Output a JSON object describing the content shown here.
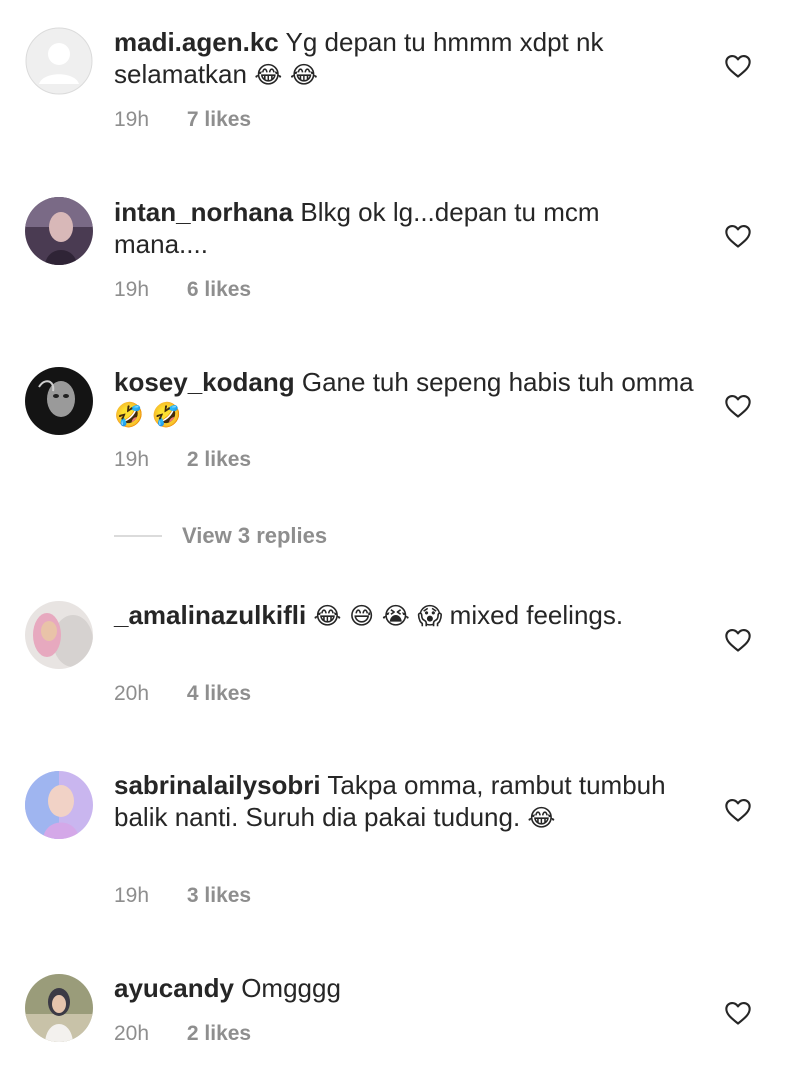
{
  "comments": [
    {
      "username": "madi.agen.kc",
      "text": "Yg depan tu hmmm xdpt nk selamatkan",
      "emojis": "😂 😂",
      "time": "19h",
      "likes": "7 likes",
      "avatar": "default-avatar"
    },
    {
      "username": "intan_norhana",
      "text": "Blkg ok lg...depan tu mcm mana....",
      "emojis": "",
      "time": "19h",
      "likes": "6 likes",
      "avatar": "photo-avatar"
    },
    {
      "username": "kosey_kodang",
      "text": "Gane tuh sepeng habis tuh omma",
      "emojis": "🤣 🤣",
      "time": "19h",
      "likes": "2 likes",
      "avatar": "photo-avatar"
    },
    {
      "username": "_amalinazulkifli",
      "emojis": "😂 😅 😭 😱",
      "text": "mixed feelings.",
      "time": "20h",
      "likes": "4 likes",
      "avatar": "photo-avatar"
    },
    {
      "username": "sabrinalailysobri",
      "text": "Takpa omma, rambut tumbuh balik nanti. Suruh dia pakai tudung.",
      "emojis": "😂",
      "time": "19h",
      "likes": "3 likes",
      "avatar": "photo-avatar"
    },
    {
      "username": "ayucandy",
      "text": "Omgggg",
      "emojis": "",
      "time": "20h",
      "likes": "2 likes",
      "avatar": "photo-avatar"
    }
  ],
  "view_replies": "View 3 replies",
  "icons": {
    "like": "heart-outline-icon"
  },
  "colors": {
    "text": "#262626",
    "meta": "#8e8e8e",
    "divider": "#dbdbdb"
  }
}
